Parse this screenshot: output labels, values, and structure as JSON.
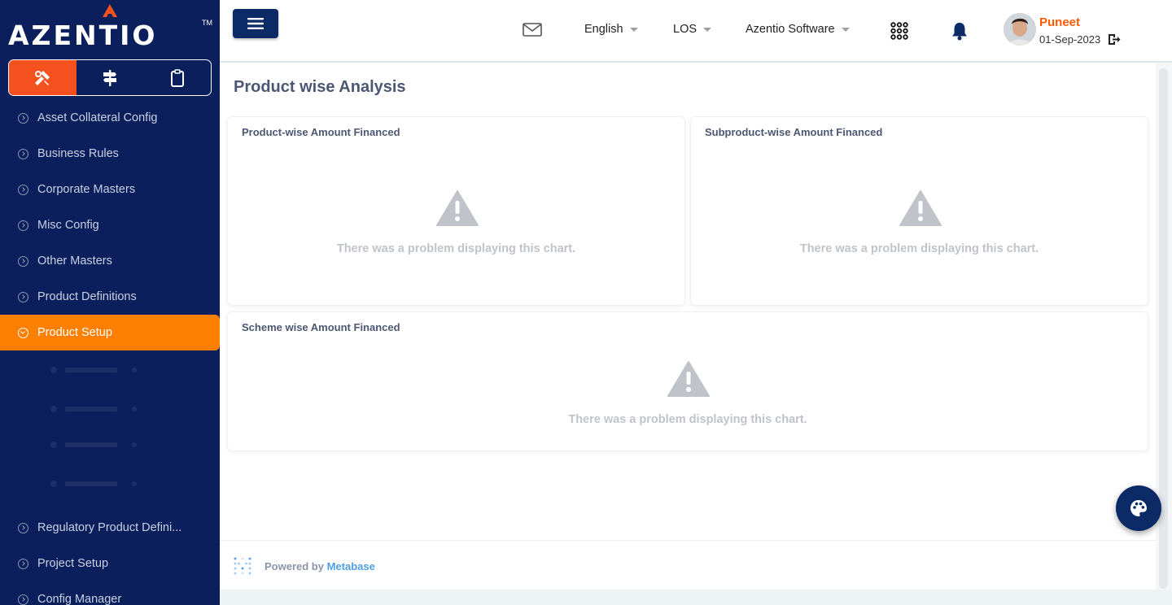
{
  "brand": {
    "name": "AZENTIO",
    "trademark": "TM",
    "accent": "#ff7f00",
    "sidebar_bg": "#0b1f5c"
  },
  "sidebar": {
    "tool_tabs": [
      {
        "icon": "tools-icon",
        "active": true
      },
      {
        "icon": "signpost-icon",
        "active": false
      },
      {
        "icon": "clipboard-icon",
        "active": false
      }
    ],
    "items": [
      {
        "label": "Asset Collateral Config"
      },
      {
        "label": "Business Rules"
      },
      {
        "label": "Corporate Masters"
      },
      {
        "label": "Misc Config"
      },
      {
        "label": "Other Masters"
      },
      {
        "label": "Product Definitions"
      },
      {
        "label": "Product Setup",
        "active": true
      },
      {
        "label": "Regulatory Product Defini..."
      },
      {
        "label": "Project Setup"
      },
      {
        "label": "Config Manager"
      }
    ]
  },
  "header": {
    "language": "English",
    "module": "LOS",
    "company": "Azentio Software",
    "user": {
      "name": "Puneet",
      "date": "01-Sep-2023"
    }
  },
  "main": {
    "title": "Product wise Analysis",
    "cards": [
      {
        "title": "Product-wise Amount Financed",
        "message": "There was a problem displaying this chart."
      },
      {
        "title": "Subproduct-wise Amount Financed",
        "message": "There was a problem displaying this chart."
      },
      {
        "title": "Scheme wise Amount Financed",
        "message": "There was a problem displaying this chart."
      }
    ],
    "footer": {
      "prefix": "Powered by",
      "link": "Metabase"
    }
  }
}
